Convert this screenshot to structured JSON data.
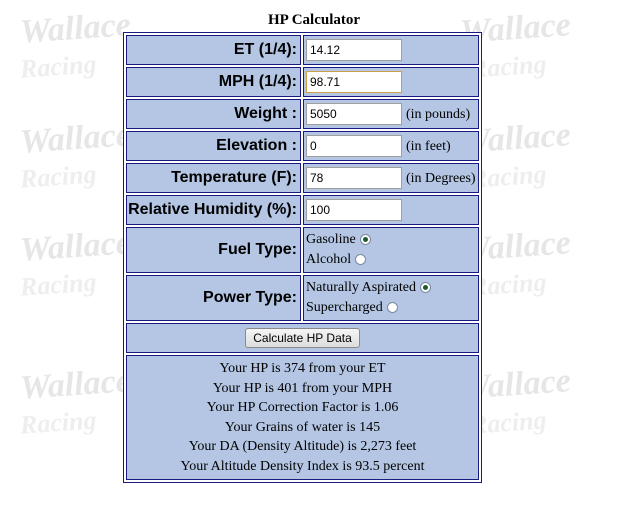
{
  "background": {
    "watermark_text": "Wallace",
    "watermark_sub": "Racing"
  },
  "title": "HP Calculator",
  "fields": {
    "et": {
      "label": "ET (1/4):",
      "value": "14.12"
    },
    "mph": {
      "label": "MPH (1/4):",
      "value": "98.71"
    },
    "weight": {
      "label": "Weight :",
      "value": "5050",
      "unit": "(in pounds)"
    },
    "elevation": {
      "label": "Elevation :",
      "value": "0",
      "unit": "(in feet)"
    },
    "temperature": {
      "label": "Temperature (F):",
      "value": "78",
      "unit": "(in Degrees)"
    },
    "humidity": {
      "label": "Relative Humidity (%):",
      "value": "100"
    }
  },
  "fuel_type": {
    "label": "Fuel Type:",
    "options": [
      "Gasoline",
      "Alcohol"
    ],
    "selected": "Gasoline"
  },
  "power_type": {
    "label": "Power Type:",
    "options": [
      "Naturally Aspirated",
      "Supercharged"
    ],
    "selected": "Naturally Aspirated"
  },
  "button_label": "Calculate HP Data",
  "results": [
    "Your HP is 374 from your ET",
    "Your HP is 401 from your MPH",
    "Your HP Correction Factor is 1.06",
    "Your Grains of water is 145",
    "Your DA (Density Altitude) is 2,273 feet",
    "Your Altitude Density Index is 93.5 percent"
  ],
  "colors": {
    "cell_background": "#b4c6e3",
    "border": "#1a1a80"
  }
}
